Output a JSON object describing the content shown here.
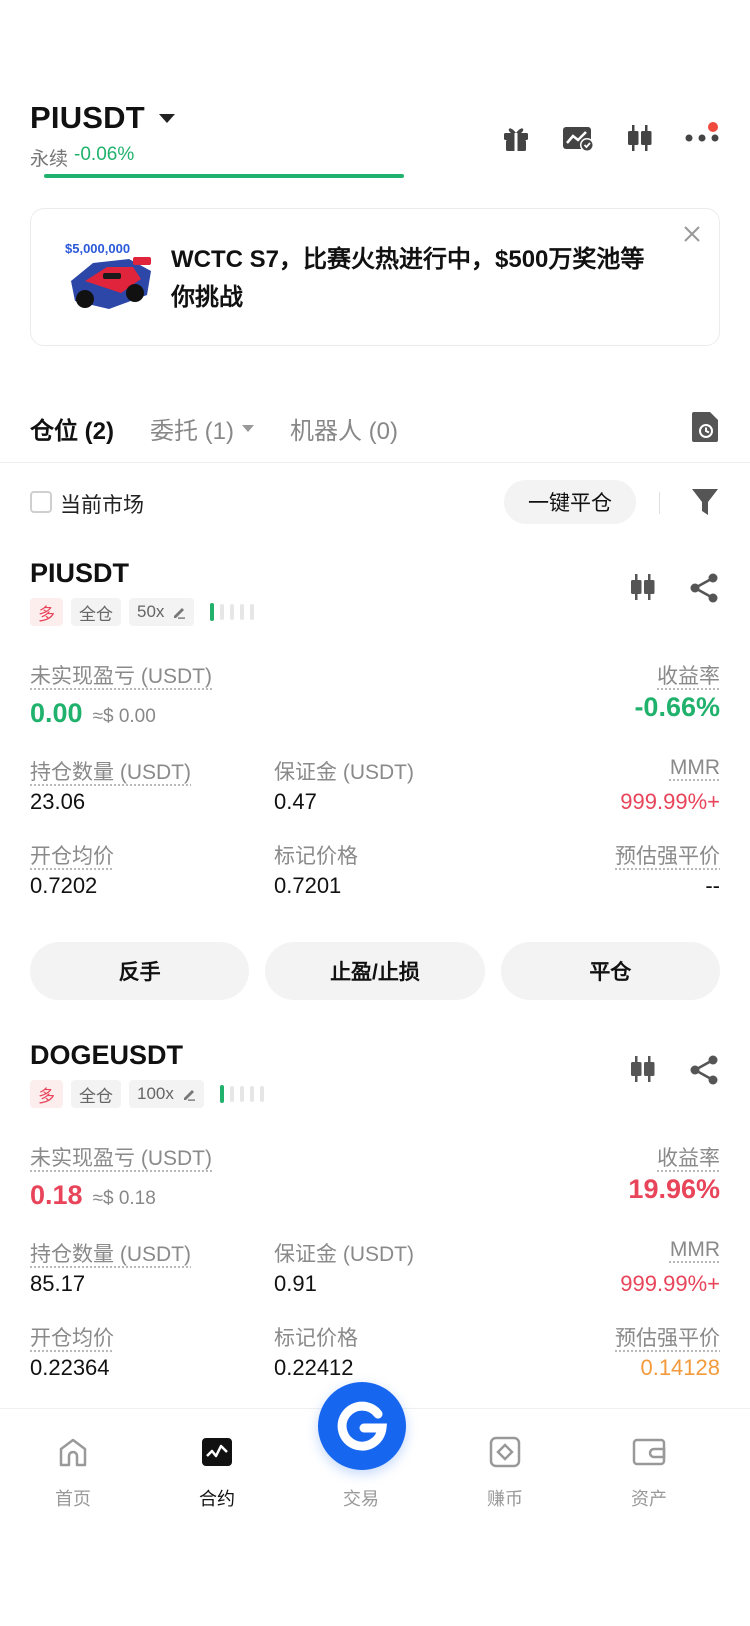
{
  "header": {
    "symbol": "PIUSDT",
    "contract_type": "永续",
    "change": "-0.06%",
    "icons": [
      "gift-icon",
      "chart-check-icon",
      "candlestick-icon",
      "more-icon"
    ]
  },
  "banner": {
    "image_text": "$5,000,000",
    "text": "WCTC S7，比赛火热进行中，$500万奖池等你挑战"
  },
  "tabs": [
    {
      "label": "仓位 (2)"
    },
    {
      "label": "委托 (1)"
    },
    {
      "label": "机器人 (0)"
    }
  ],
  "filter": {
    "checkbox_label": "当前市场",
    "close_all_label": "一键平仓"
  },
  "labels": {
    "unrealized_pnl": "未实现盈亏 (USDT)",
    "roe": "收益率",
    "size": "持仓数量 (USDT)",
    "margin": "保证金 (USDT)",
    "mmr": "MMR",
    "entry_price": "开仓均价",
    "mark_price": "标记价格",
    "liq_price": "预估强平价"
  },
  "positions": [
    {
      "symbol": "PIUSDT",
      "side": "多",
      "margin_mode": "全仓",
      "leverage": "50x",
      "pnl": "0.00",
      "pnl_usd": "≈$ 0.00",
      "roe": "-0.66%",
      "size": "23.06",
      "margin": "0.47",
      "mmr": "999.99%+",
      "entry_price": "0.7202",
      "mark_price": "0.7201",
      "liq_price": "--",
      "buttons": [
        "反手",
        "止盈/止损",
        "平仓"
      ]
    },
    {
      "symbol": "DOGEUSDT",
      "side": "多",
      "margin_mode": "全仓",
      "leverage": "100x",
      "pnl": "0.18",
      "pnl_usd": "≈$ 0.18",
      "roe": "19.96%",
      "size": "85.17",
      "margin": "0.91",
      "mmr": "999.99%+",
      "entry_price": "0.22364",
      "mark_price": "0.22412",
      "liq_price": "0.14128"
    }
  ],
  "nav": [
    {
      "label": "首页"
    },
    {
      "label": "合约"
    },
    {
      "label": "交易"
    },
    {
      "label": "赚币"
    },
    {
      "label": "资产"
    }
  ],
  "colors": {
    "green": "#20b26c",
    "red": "#e8445a",
    "orange": "#f39a3d",
    "brand_blue": "#1766f0"
  }
}
